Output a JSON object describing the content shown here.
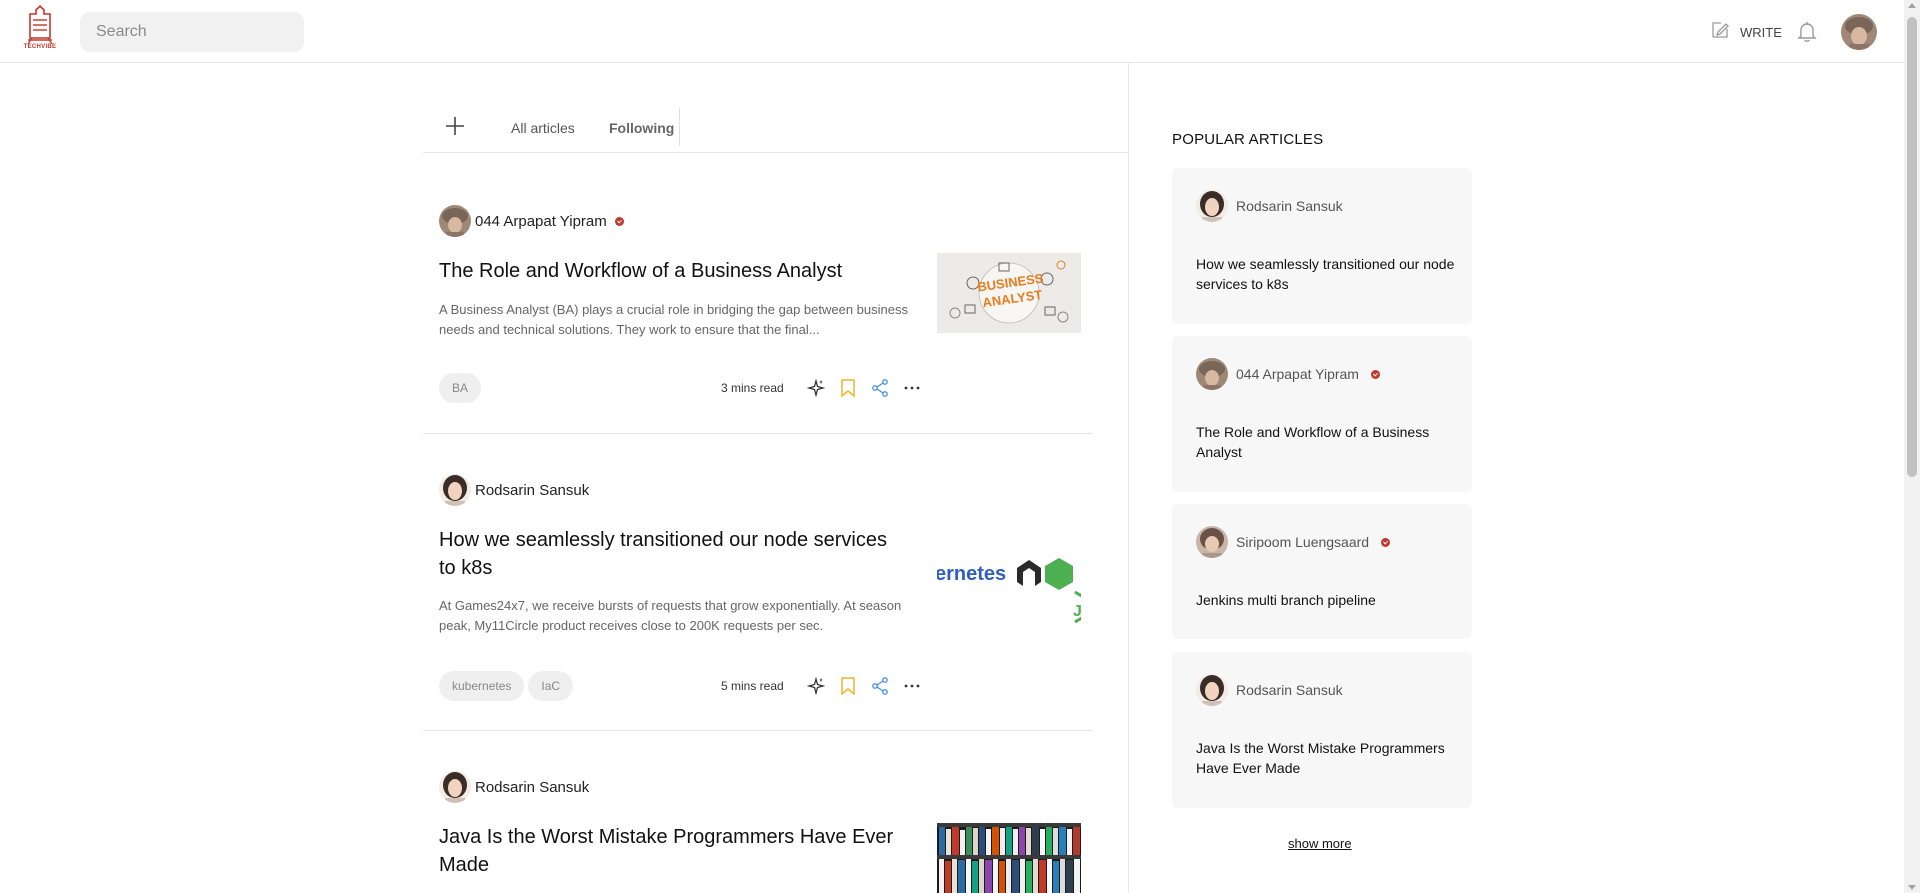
{
  "brand": {
    "logo_text": "TECHVIBE"
  },
  "header": {
    "search_placeholder": "Search",
    "write_label": "WRITE"
  },
  "tabs": {
    "all_articles": "All articles",
    "following": "Following"
  },
  "articles": [
    {
      "author": "044 Arpapat Yipram",
      "verified": true,
      "title": "The Role and Workflow of a Business Analyst",
      "description": "A Business Analyst (BA) plays a crucial role in bridging the gap between business needs and technical solutions. They work to ensure that the final...",
      "tags": [
        "BA"
      ],
      "read_time": "3 mins read",
      "thumbnail_text": "BUSINESS ANALYST"
    },
    {
      "author": "Rodsarin Sansuk",
      "verified": false,
      "title": "How we seamlessly transitioned our node services to k8s",
      "description": "At Games24x7, we receive bursts of requests that grow exponentially. At season peak, My11Circle product receives close to 200K requests per sec.",
      "tags": [
        "kubernetes",
        "IaC"
      ],
      "read_time": "5 mins read",
      "thumbnail_text": "ernetes"
    },
    {
      "author": "Rodsarin Sansuk",
      "verified": false,
      "title": "Java Is the Worst Mistake Programmers Have Ever Made"
    }
  ],
  "sidebar": {
    "heading": "POPULAR ARTICLES",
    "cards": [
      {
        "author": "Rodsarin Sansuk",
        "verified": false,
        "title": "How we seamlessly transitioned our node services to k8s"
      },
      {
        "author": "044 Arpapat Yipram",
        "verified": true,
        "title": "The Role and Workflow of a Business Analyst"
      },
      {
        "author": "Siripoom Luengsaard",
        "verified": true,
        "title": "Jenkins multi branch pipeline"
      },
      {
        "author": "Rodsarin Sansuk",
        "verified": false,
        "title": "Java Is the Worst Mistake Programmers Have Ever Made"
      }
    ],
    "show_more": "show more"
  },
  "colors": {
    "brand_red": "#c0392b",
    "bookmark": "#f0b429",
    "share": "#4a90e2"
  },
  "icons": [
    "pen-icon",
    "bell-icon",
    "plus-icon",
    "sparkle-icon",
    "bookmark-icon",
    "share-icon",
    "more-icon",
    "verified-badge-icon"
  ]
}
